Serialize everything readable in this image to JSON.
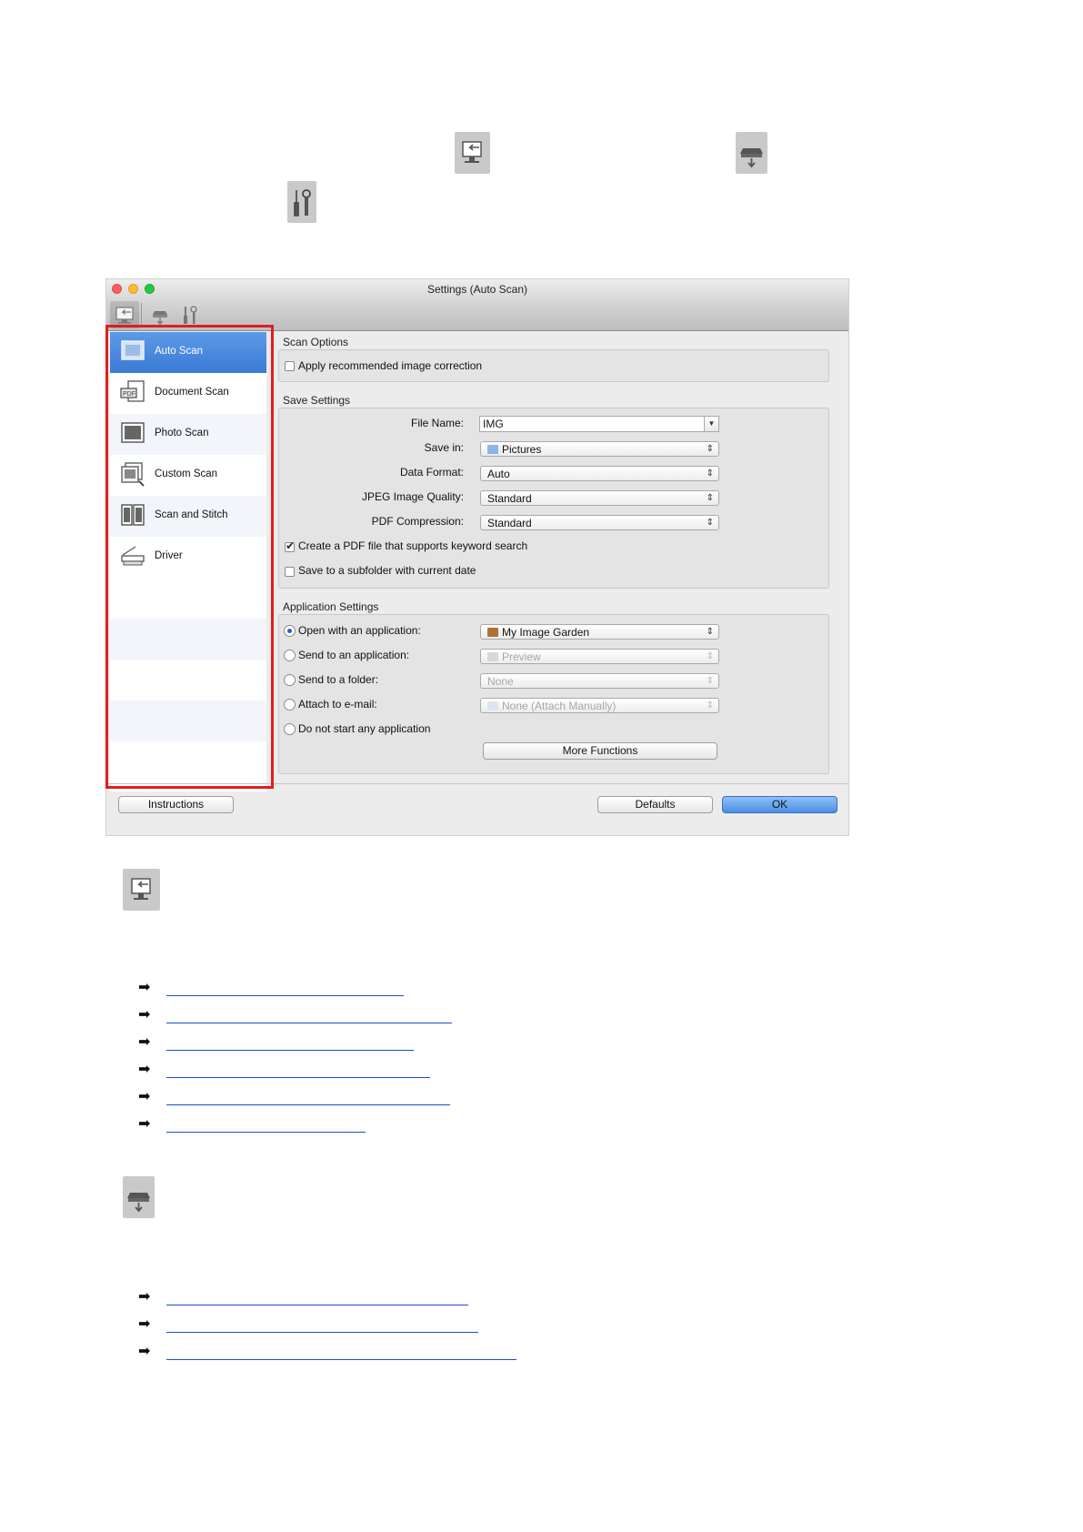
{
  "window": {
    "title": "Settings (Auto Scan)",
    "toolbar_tabs": [
      {
        "name": "scan-from-computer-tab",
        "icon": "computer-scan-icon",
        "selected": true
      },
      {
        "name": "scan-from-operation-panel-tab",
        "icon": "scanner-panel-icon",
        "selected": false
      },
      {
        "name": "general-settings-tab",
        "icon": "tools-icon",
        "selected": false
      }
    ]
  },
  "sidebar": {
    "items": [
      {
        "label": "Auto Scan",
        "icon": "auto-scan-icon",
        "selected": true
      },
      {
        "label": "Document Scan",
        "icon": "pdf-document-icon",
        "selected": false
      },
      {
        "label": "Photo Scan",
        "icon": "photo-icon",
        "selected": false
      },
      {
        "label": "Custom Scan",
        "icon": "custom-scan-icon",
        "selected": false
      },
      {
        "label": "Scan and Stitch",
        "icon": "stitch-icon",
        "selected": false
      },
      {
        "label": "Driver",
        "icon": "scanner-driver-icon",
        "selected": false
      }
    ]
  },
  "scan_options": {
    "title": "Scan Options",
    "apply_correction": {
      "label": "Apply recommended image correction",
      "checked": false
    }
  },
  "save_settings": {
    "title": "Save Settings",
    "file_name": {
      "label": "File Name:",
      "value": "IMG"
    },
    "save_in": {
      "label": "Save in:",
      "value": "Pictures"
    },
    "data_format": {
      "label": "Data Format:",
      "value": "Auto"
    },
    "jpeg_quality": {
      "label": "JPEG Image Quality:",
      "value": "Standard"
    },
    "pdf_compression": {
      "label": "PDF Compression:",
      "value": "Standard"
    },
    "keyword_search": {
      "label": "Create a PDF file that supports keyword search",
      "checked": true
    },
    "subfolder": {
      "label": "Save to a subfolder with current date",
      "checked": false
    }
  },
  "app_settings": {
    "title": "Application Settings",
    "open_app": {
      "label": "Open with an application:",
      "value": "My Image Garden",
      "selected": true
    },
    "send_app": {
      "label": "Send to an application:",
      "value": "Preview",
      "selected": false
    },
    "send_folder": {
      "label": "Send to a folder:",
      "value": "None",
      "selected": false
    },
    "attach_email": {
      "label": "Attach to e-mail:",
      "value": "None (Attach Manually)",
      "selected": false
    },
    "do_not_start": {
      "label": "Do not start any application",
      "selected": false
    },
    "more_functions_label": "More Functions"
  },
  "buttons": {
    "instructions": "Instructions",
    "defaults": "Defaults",
    "ok": "OK"
  },
  "colors": {
    "sidebar_highlight": "#e21d1d",
    "selection_blue": "#3b7ad6",
    "link": "#1a4fd1"
  }
}
